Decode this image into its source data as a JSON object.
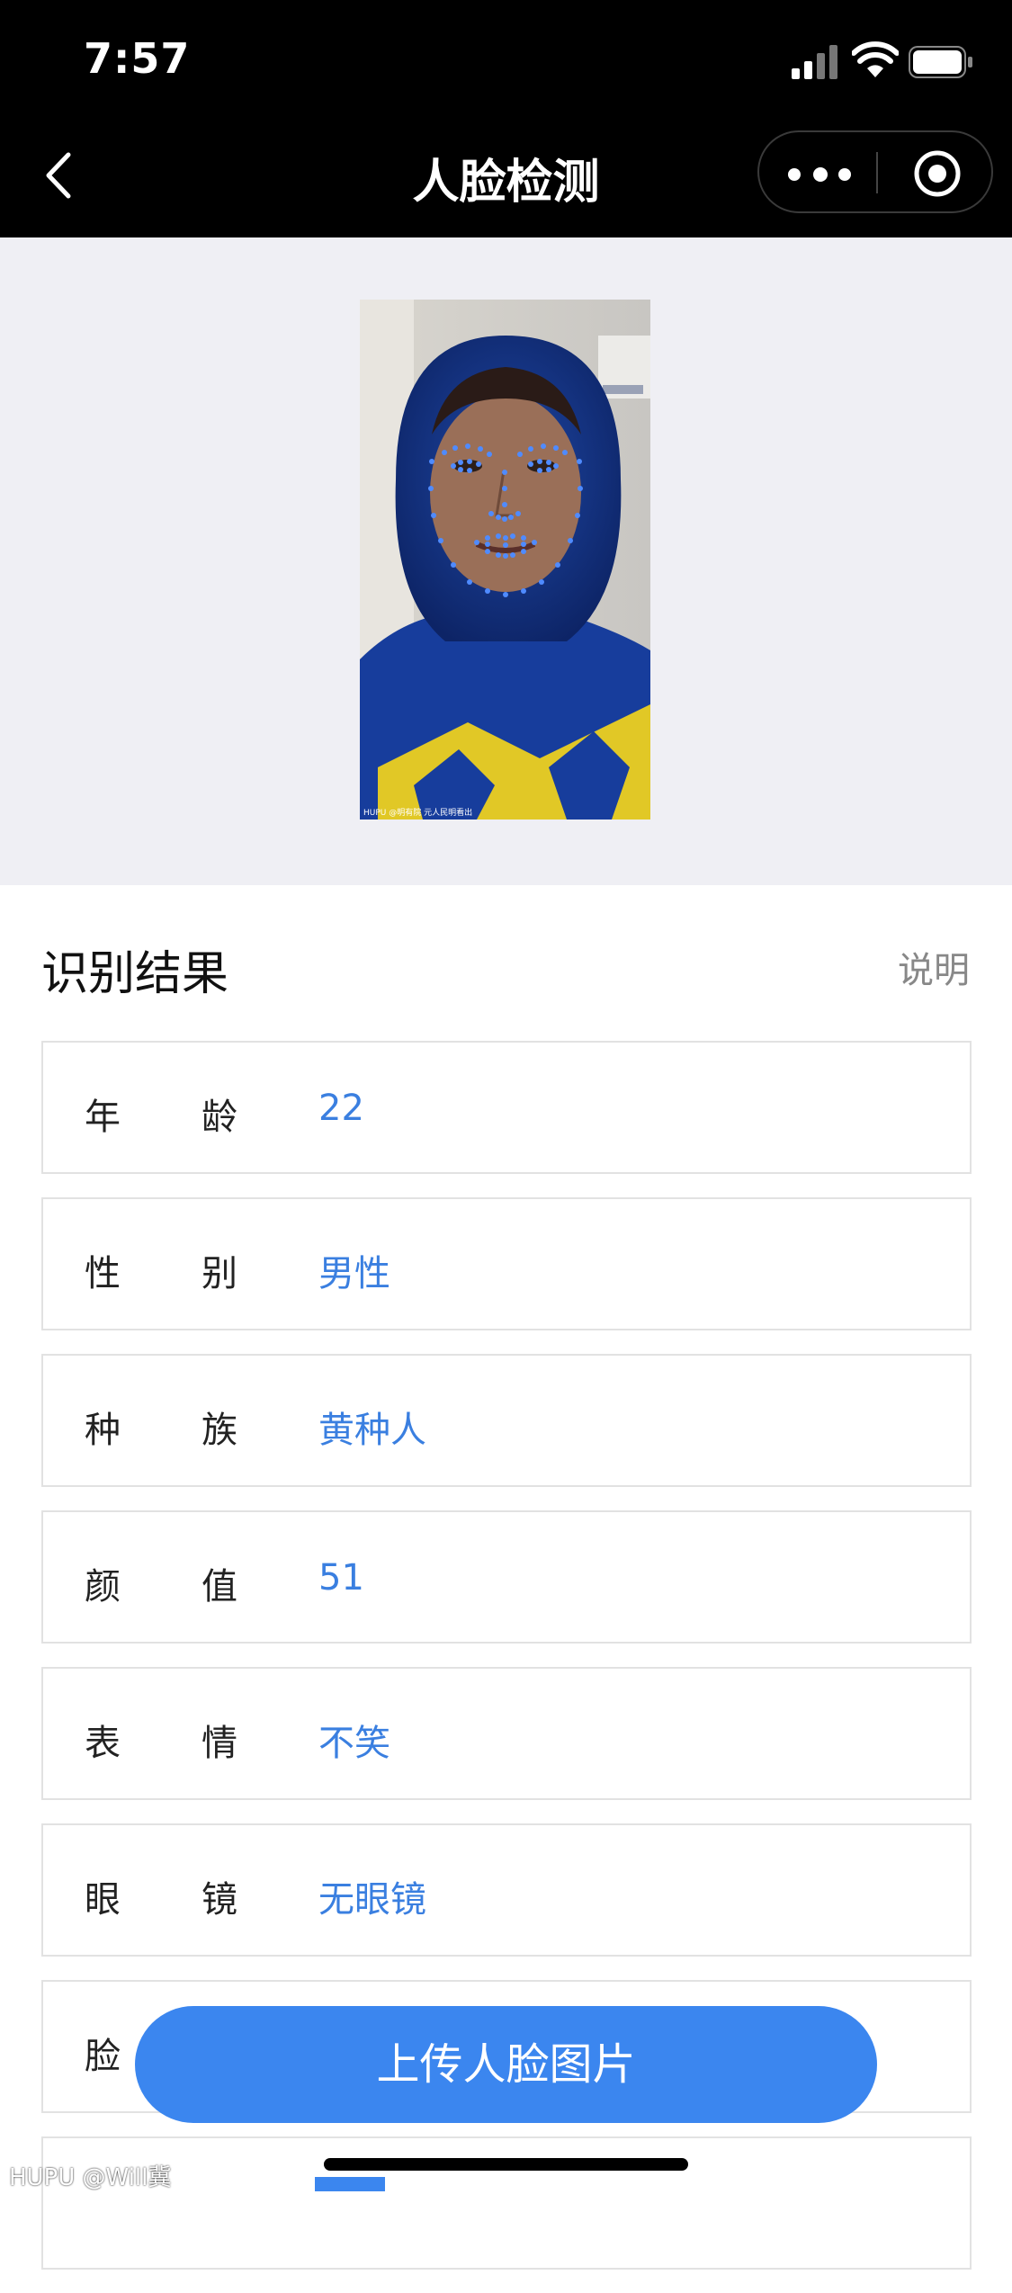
{
  "status_bar": {
    "time": "7:57"
  },
  "nav": {
    "title": "人脸检测"
  },
  "result": {
    "section_title": "识别结果",
    "explain_label": "说明",
    "rows": [
      {
        "label_a": "年",
        "label_b": "龄",
        "value": "22"
      },
      {
        "label_a": "性",
        "label_b": "别",
        "value": "男性"
      },
      {
        "label_a": "种",
        "label_b": "族",
        "value": "黄种人"
      },
      {
        "label_a": "颜",
        "label_b": "值",
        "value": "51"
      },
      {
        "label_a": "表",
        "label_b": "情",
        "value": "不笑"
      },
      {
        "label_a": "眼",
        "label_b": "镜",
        "value": "无眼镜"
      },
      {
        "label_a": "脸",
        "label_b": "",
        "value": ""
      }
    ]
  },
  "upload_button": {
    "label": "上传人脸图片"
  },
  "photo": {
    "caption": "HUPU @明有院 元人民明看出"
  },
  "watermark": {
    "text": "HUPU @Will冀"
  },
  "colors": {
    "accent": "#3b86ef",
    "value_text": "#3a7fe0",
    "landmark": "#4f8bff"
  }
}
